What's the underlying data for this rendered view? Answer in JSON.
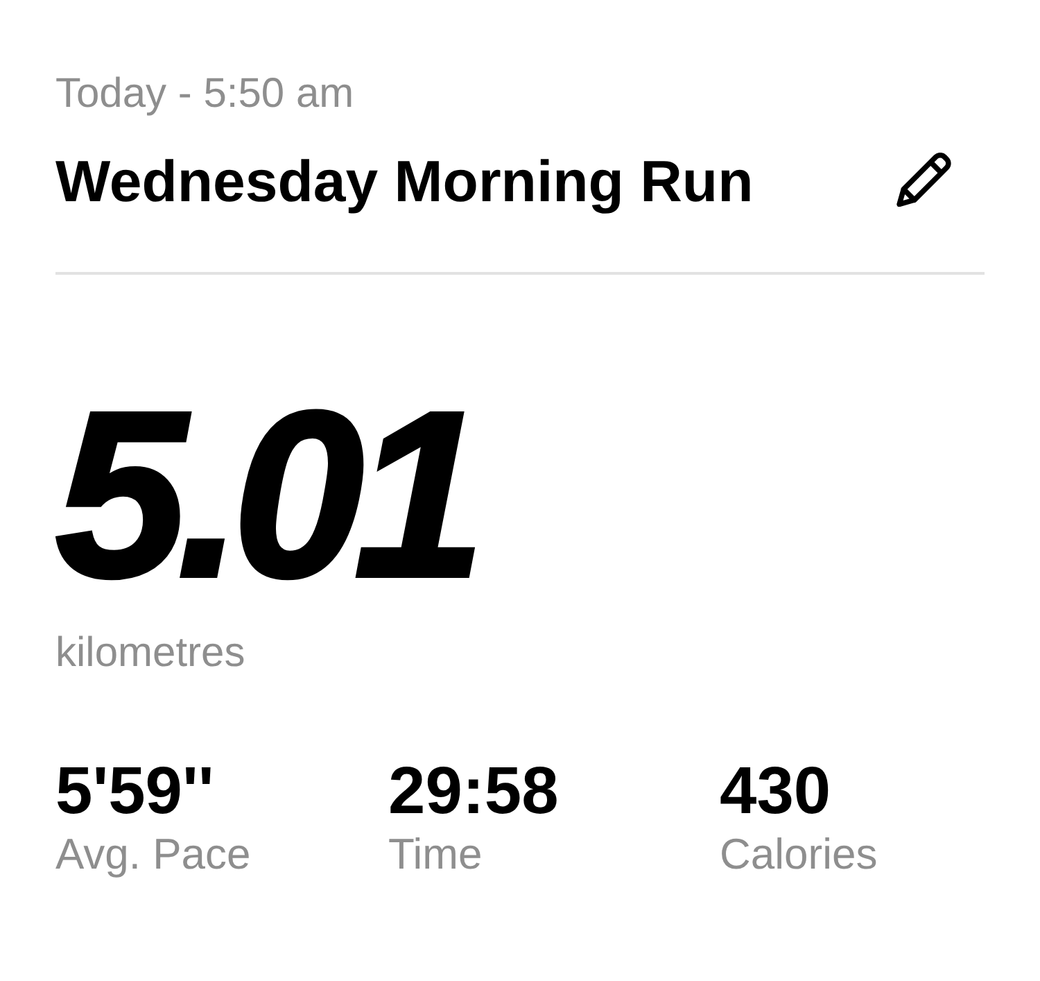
{
  "header": {
    "date": "Today - 5:50 am",
    "title": "Wednesday Morning Run"
  },
  "distance": {
    "value": "5.01",
    "unit": "kilometres"
  },
  "stats": [
    {
      "value": "5'59''",
      "label": "Avg. Pace"
    },
    {
      "value": "29:58",
      "label": "Time"
    },
    {
      "value": "430",
      "label": "Calories"
    }
  ]
}
